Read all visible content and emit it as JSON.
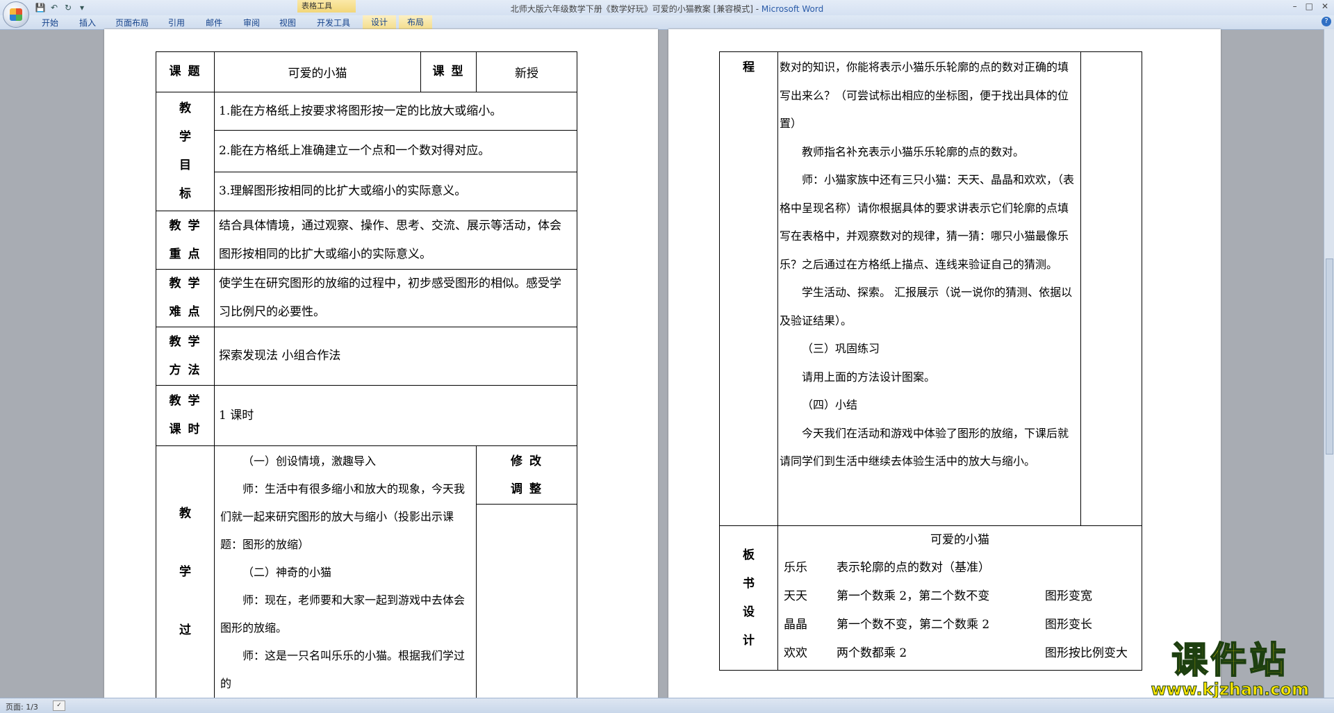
{
  "window": {
    "title": "北师大版六年级数学下册《数学好玩》可爱的小猫教案 [兼容模式] - ",
    "app_name": "Microsoft Word",
    "contextual_tools_label": "表格工具",
    "controls": [
      "–",
      "□",
      "✕"
    ]
  },
  "ribbon": {
    "tabs": [
      "开始",
      "插入",
      "页面布局",
      "引用",
      "邮件",
      "审阅",
      "视图",
      "开发工具",
      "设计",
      "布局"
    ]
  },
  "qat": {
    "save": "💾",
    "undo": "↶",
    "redo": "↻",
    "more": "▾"
  },
  "page1": {
    "topic_label": "课 题",
    "topic": "可爱的小猫",
    "type_label": "课 型",
    "type": "新授",
    "goals_label_chars": [
      "教",
      "学",
      "目",
      "标"
    ],
    "goals": [
      "1.能在方格纸上按要求将图形按一定的比放大或缩小。",
      "2.能在方格纸上准确建立一个点和一个数对得对应。",
      "3.理解图形按相同的比扩大或缩小的实际意义。"
    ],
    "focus_label": [
      "教 学",
      "重 点"
    ],
    "focus": "结合具体情境，通过观察、操作、思考、交流、展示等活动，体会图形按相同的比扩大或缩小的实际意义。",
    "difficulty_label": [
      "教 学",
      "难 点"
    ],
    "difficulty": "使学生在研究图形的放缩的过程中，初步感受图形的相似。感受学习比例尺的必要性。",
    "method_label": [
      "教 学",
      "方 法"
    ],
    "method": "探索发现法 小组合作法",
    "hours_label": [
      "教 学",
      "课 时"
    ],
    "hours": "1 课时",
    "process_label_chars": [
      "教",
      "学",
      "过"
    ],
    "revise_label": [
      "修 改",
      "调 整"
    ],
    "process_paragraphs": [
      "（一）创设情境，激趣导入",
      "师：生活中有很多缩小和放大的现象，今天我们就一起来研究图形的放大与缩小（投影出示课题：图形的放缩）",
      "（二）神奇的小猫",
      "师：现在，老师要和大家一起到游戏中去体会图形的放缩。",
      "师：这是一只名叫乐乐的小猫。根据我们学过的"
    ]
  },
  "page2": {
    "process_label": "程",
    "process_paragraphs": [
      "数对的知识，你能将表示小猫乐乐轮廓的点的数对正确的填写出来么？（可尝试标出相应的坐标图，便于找出具体的位置）",
      "教师指名补充表示小猫乐乐轮廓的点的数对。",
      "师：小猫家族中还有三只小猫：天天、晶晶和欢欢，（表格中呈现名称）请你根据具体的要求讲表示它们轮廓的点填写在表格中，并观察数对的规律，猜一猜：哪只小猫最像乐乐？之后通过在方格纸上描点、连线来验证自己的猜测。",
      "学生活动、探索。  汇报展示（说一说你的猜测、依据以及验证结果）。",
      "（三）巩固练习",
      "请用上面的方法设计图案。",
      "（四）小结",
      "今天我们在活动和游戏中体验了图形的放缩，下课后就请同学们到生活中继续去体验生活中的放大与缩小。"
    ],
    "board_label_chars": [
      "板",
      "书",
      "设",
      "计"
    ],
    "board_title": "可爱的小猫",
    "board_rows": [
      {
        "name": "乐乐",
        "rule": "表示轮廓的点的数对（基准）",
        "effect": ""
      },
      {
        "name": "天天",
        "rule": "第一个数乘 2，第二个数不变",
        "effect": "图形变宽"
      },
      {
        "name": "晶晶",
        "rule": "第一个数不变，第二个数乘 2",
        "effect": "图形变长"
      },
      {
        "name": "欢欢",
        "rule": "两个数都乘 2",
        "effect": "图形按比例变大"
      }
    ]
  },
  "status": {
    "page": "页面: 1/3"
  },
  "watermark": {
    "text": "课件站",
    "url": "www.kjzhan.com"
  }
}
